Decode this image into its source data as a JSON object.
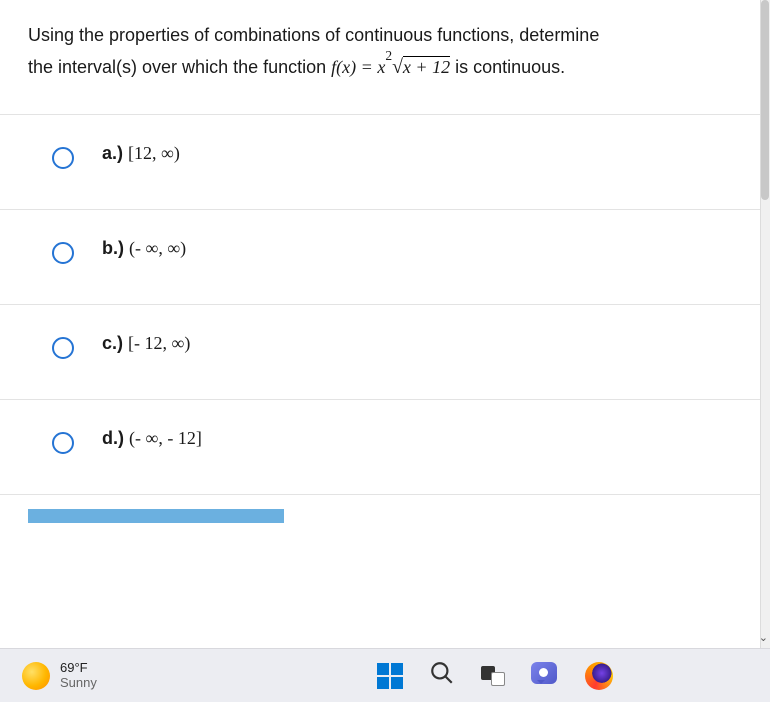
{
  "question": {
    "line1": "Using the properties of combinations of continuous functions, determine",
    "line2_pre": "the interval(s) over which the function ",
    "line2_post": " is continuous.",
    "formula_fn": "f",
    "formula_var": "x",
    "formula_const": "12"
  },
  "options": [
    {
      "label": "a.)",
      "text": "[12, ∞)"
    },
    {
      "label": "b.)",
      "text": "(- ∞, ∞)"
    },
    {
      "label": "c.)",
      "text": "[- 12, ∞)"
    },
    {
      "label": "d.)",
      "text": "(- ∞, - 12]"
    }
  ],
  "taskbar": {
    "temp": "69°F",
    "condition": "Sunny"
  }
}
